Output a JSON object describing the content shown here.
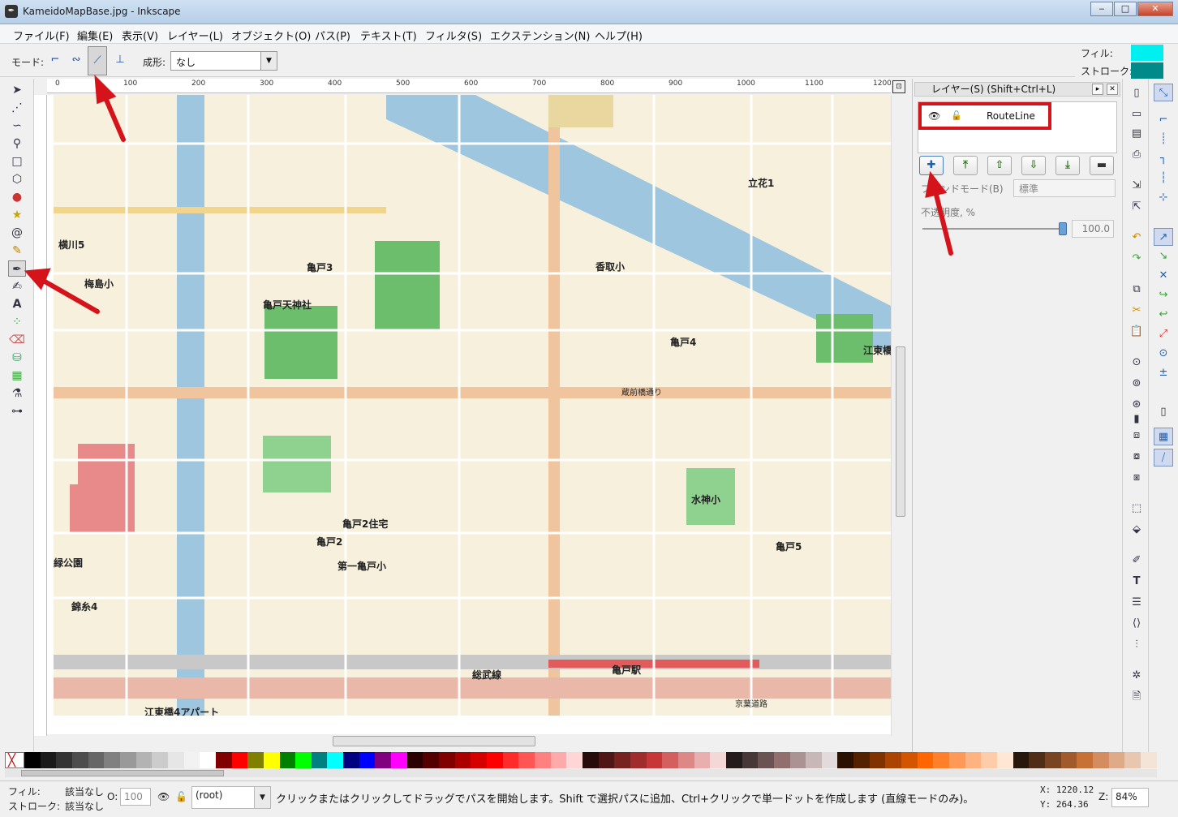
{
  "window": {
    "title": "KameidoMapBase.jpg - Inkscape",
    "controls": [
      "‒",
      "□",
      "✕"
    ]
  },
  "menu": [
    "ファイル(F)",
    "編集(E)",
    "表示(V)",
    "レイヤー(L)",
    "オブジェクト(O)",
    "パス(P)",
    "テキスト(T)",
    "フィルタ(S)",
    "エクステンション(N)",
    "ヘルプ(H)"
  ],
  "tool_controls": {
    "mode_label": "モード:",
    "shape_label": "成形:",
    "shape_value": "なし"
  },
  "fill_stroke": {
    "fill_label": "フィル:",
    "stroke_label": "ストローク:",
    "fill_color": "#00f0f0",
    "stroke_color": "#008a8a"
  },
  "ruler": {
    "ticks": [
      "0",
      "100",
      "200",
      "300",
      "400",
      "500",
      "600",
      "700",
      "800",
      "900",
      "1000",
      "1100",
      "1200"
    ]
  },
  "map": {
    "labels": [
      "亀戸天神社",
      "亀戸3",
      "亀戸4",
      "亀戸5",
      "亀戸2",
      "亀戸2住宅",
      "亀戸駅",
      "香取小",
      "水神小",
      "梅島小",
      "立花1",
      "江東橋",
      "第一亀戸小",
      "蔵前橋通り",
      "京葉道路",
      "横川5",
      "錦糸4",
      "総武線",
      "緑公園",
      "江東橋4アパート"
    ]
  },
  "layers": {
    "panel_title": "レイヤー(S) (Shift+Ctrl+L)",
    "layer_name": "RouteLine",
    "blend_label": "ブレンドモード(B)",
    "blend_value": "標準",
    "opacity_label": "不透明度, %",
    "opacity_value": "100.0",
    "opacity_fraction": 1.0
  },
  "palette": {
    "colors": [
      "#000000",
      "#1a1a1a",
      "#333333",
      "#4d4d4d",
      "#666666",
      "#808080",
      "#999999",
      "#b3b3b3",
      "#cccccc",
      "#e6e6e6",
      "#f2f2f2",
      "#ffffff",
      "#800000",
      "#ff0000",
      "#808000",
      "#ffff00",
      "#008000",
      "#00ff00",
      "#008080",
      "#00ffff",
      "#000080",
      "#0000ff",
      "#800080",
      "#ff00ff",
      "#2b0000",
      "#550000",
      "#800000",
      "#aa0000",
      "#d40000",
      "#ff0000",
      "#ff2a2a",
      "#ff5555",
      "#ff8080",
      "#ffaaaa",
      "#ffd5d5",
      "#280b0b",
      "#501616",
      "#782121",
      "#a02c2c",
      "#c83737",
      "#d35f5f",
      "#de8787",
      "#e9afaf",
      "#f4d7d7",
      "#241c1c",
      "#483737",
      "#6c5353",
      "#916f6f",
      "#ac9393",
      "#c8b7b7",
      "#e3dbdb",
      "#2b1100",
      "#552200",
      "#803300",
      "#aa4400",
      "#d45500",
      "#ff6600",
      "#ff7f2a",
      "#ff9955",
      "#ffb380",
      "#ffccaa",
      "#ffe6d5",
      "#28170b",
      "#502d16",
      "#784421",
      "#a05a2c",
      "#c87137",
      "#d38d5f",
      "#deaa87",
      "#e9c6af",
      "#f4e3d7"
    ]
  },
  "status": {
    "fill_label": "フィル:",
    "fill_value": "該当なし",
    "stroke_label": "ストローク:",
    "stroke_value": "該当なし",
    "opacity_prefix": "O:",
    "opacity_value": "100",
    "layer_value": "(root)",
    "message": "クリックまたはクリックしてドラッグでパスを開始します。Shift で選択パスに追加、Ctrl+クリックで単一ドットを作成します (直線モードのみ)。",
    "x": "X: 1220.12",
    "y": "Y:  264.36",
    "zoom_label": "Z:",
    "zoom_value": "84%"
  }
}
